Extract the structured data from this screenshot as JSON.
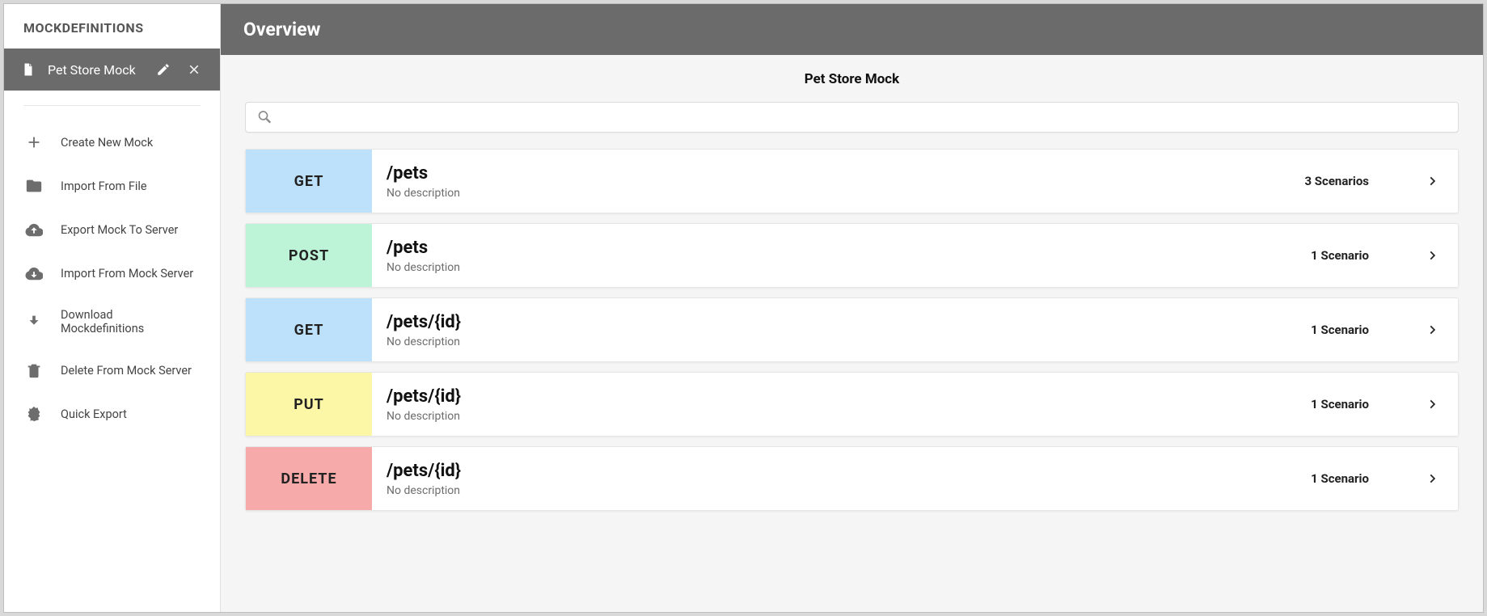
{
  "sidebar": {
    "header": "MOCKDEFINITIONS",
    "active_mock": "Pet Store Mock",
    "menu": [
      {
        "icon": "plus",
        "label": "Create New Mock"
      },
      {
        "icon": "folder",
        "label": "Import From File"
      },
      {
        "icon": "cloud-upload",
        "label": "Export Mock To Server"
      },
      {
        "icon": "cloud-download",
        "label": "Import From Mock Server"
      },
      {
        "icon": "download",
        "label": "Download Mockdefinitions"
      },
      {
        "icon": "trash",
        "label": "Delete From Mock Server"
      },
      {
        "icon": "badge",
        "label": "Quick Export"
      }
    ]
  },
  "main": {
    "topbar_title": "Overview",
    "page_title": "Pet Store Mock",
    "search_placeholder": "",
    "endpoints": [
      {
        "method": "GET",
        "method_class": "m-get",
        "path": "/pets",
        "description": "No description",
        "scenarios": "3 Scenarios"
      },
      {
        "method": "POST",
        "method_class": "m-post",
        "path": "/pets",
        "description": "No description",
        "scenarios": "1 Scenario"
      },
      {
        "method": "GET",
        "method_class": "m-get",
        "path": "/pets/{id}",
        "description": "No description",
        "scenarios": "1 Scenario"
      },
      {
        "method": "PUT",
        "method_class": "m-put",
        "path": "/pets/{id}",
        "description": "No description",
        "scenarios": "1 Scenario"
      },
      {
        "method": "DELETE",
        "method_class": "m-delete",
        "path": "/pets/{id}",
        "description": "No description",
        "scenarios": "1 Scenario"
      }
    ]
  }
}
